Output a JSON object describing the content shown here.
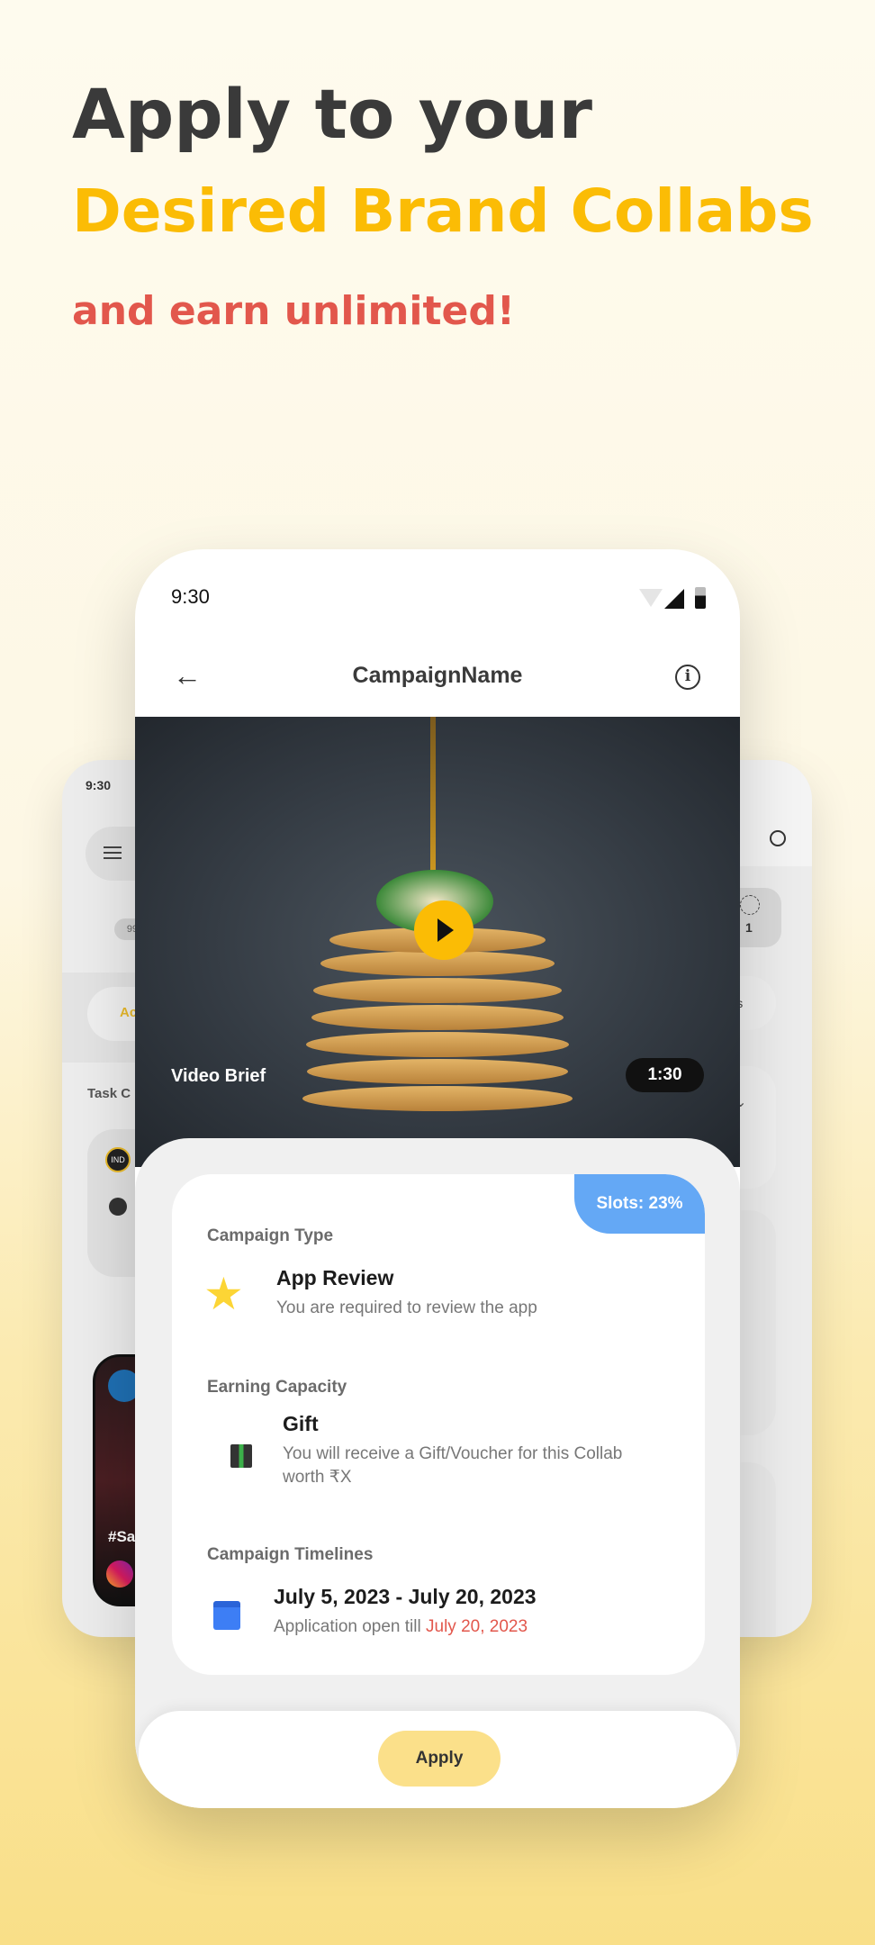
{
  "headline": {
    "line1": "Apply to your",
    "line2": "Desired Brand Collabs",
    "line3": "and earn unlimited!"
  },
  "colors": {
    "headline_dark": "#3a3a3a",
    "headline_yellow": "#fbbc05",
    "headline_red": "#e2574c",
    "slots_badge": "#64a8f5",
    "apply_button": "#fbe08a",
    "deadline_red": "#e2574c"
  },
  "back_left": {
    "time": "9:30",
    "badge": "99",
    "tab": "Ac",
    "section": "Task C",
    "hashtag": "#Sa",
    "logo": "IND"
  },
  "back_right": {
    "count": "1",
    "tab": "ils"
  },
  "status_bar": {
    "time": "9:30"
  },
  "header": {
    "title": "CampaignName",
    "back_icon": "arrow-left-icon",
    "info_icon": "info-icon"
  },
  "video": {
    "label": "Video Brief",
    "duration": "1:30"
  },
  "slots": {
    "label": "Slots: 23%",
    "value_percent": 23
  },
  "campaign_type": {
    "label": "Campaign Type",
    "title": "App Review",
    "desc": "You are required to review the app"
  },
  "earning": {
    "label": "Earning Capacity",
    "title": "Gift",
    "desc": "You will receive a Gift/Voucher for this Collab worth ₹X"
  },
  "timeline": {
    "label": "Campaign Timelines",
    "dates": "July 5, 2023 - July 20, 2023",
    "open_prefix": "Application open till ",
    "open_date": "July 20, 2023"
  },
  "apply_label": "Apply"
}
